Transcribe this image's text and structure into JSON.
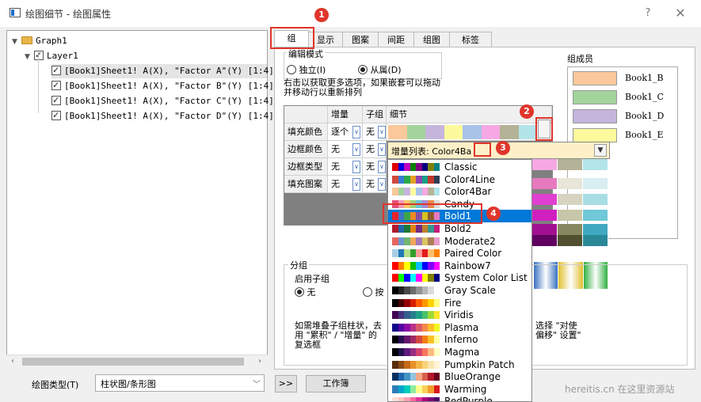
{
  "window": {
    "title": "绘图细节 - 绘图属性",
    "help_label": "?",
    "close_label": "✕"
  },
  "tree": {
    "root": "Graph1",
    "layer": "Layer1",
    "items": [
      "[Book1]Sheet1! A(X), \"Factor A\"(Y) [1:4]",
      "[Book1]Sheet1! A(X), \"Factor B\"(Y) [1:4]",
      "[Book1]Sheet1! A(X), \"Factor C\"(Y) [1:4]",
      "[Book1]Sheet1! A(X), \"Factor D\"(Y) [1:4]"
    ]
  },
  "bottom": {
    "plot_type_label": "绘图类型(T)",
    "plot_type_value": "柱状图/条形图",
    "expand_label": ">>",
    "workbook_label": "工作簿",
    "watermark": "hereitis.cn 在这里资源站"
  },
  "tabs": [
    "组",
    "显示",
    "图案",
    "间距",
    "组图",
    "标签"
  ],
  "edit_mode": {
    "title": "编辑模式",
    "independent": "独立(I)",
    "dependent": "从属(D)"
  },
  "hint": [
    "右击以获取更多选项，如果嵌套可以拖动",
    "并移动行以重新排列"
  ],
  "grid": {
    "headers": [
      "增量",
      "子组",
      "细节"
    ],
    "rows": [
      {
        "name": "填充颜色",
        "inc": "逐个",
        "sub": "无"
      },
      {
        "name": "边框颜色",
        "inc": "无",
        "sub": "无"
      },
      {
        "name": "边框类型",
        "inc": "无",
        "sub": "无"
      },
      {
        "name": "填充图案",
        "inc": "无",
        "sub": "无"
      }
    ],
    "details_colors": [
      "#f9c89b",
      "#a3d49c",
      "#c5b5dd",
      "#fdfa9e",
      "#a7c3e8",
      "#f6a8e4",
      "#b4b297",
      "#b2e4ea"
    ]
  },
  "members": {
    "title": "组成员",
    "items": [
      {
        "label": "Book1_B",
        "color": "#f9c89b"
      },
      {
        "label": "Book1_C",
        "color": "#a3d49c"
      },
      {
        "label": "Book1_D",
        "color": "#c5b5dd"
      },
      {
        "label": "Book1_E",
        "color": "#fdfa9e"
      }
    ]
  },
  "subgroup": {
    "title": "分组",
    "enable_label": "启用子组",
    "option_none": "无",
    "option_by": "按",
    "note": [
      "如需堆叠子组柱状，去",
      "选择 \"对使",
      "用 \"累积\" / \"增量\" 的",
      "偏移\" 设置\"",
      "复选框"
    ]
  },
  "dropdown": {
    "header": "增量列表: Color4Ba",
    "items": [
      {
        "name": "Classic",
        "colors": [
          "#e00000",
          "#0000e0",
          "#c000c0",
          "#008000",
          "#800080",
          "#000080",
          "#808000",
          "#008080"
        ]
      },
      {
        "name": "Color4Line",
        "colors": [
          "#d04a3c",
          "#3a7bd5",
          "#2aa84a",
          "#e6a020",
          "#8e44ad",
          "#16a085",
          "#c0392b",
          "#2c3e50"
        ]
      },
      {
        "name": "Color4Bar",
        "colors": [
          "#f9c89b",
          "#a3d49c",
          "#c5b5dd",
          "#fdfa9e",
          "#a7c3e8",
          "#f6a8e4",
          "#b4b297",
          "#b2e4ea"
        ]
      },
      {
        "name": "Candy",
        "colors": [
          "#e5517a",
          "#f29cb7",
          "#f6c86a",
          "#9fd37a",
          "#6cc3d5",
          "#a58bd6",
          "#e88b4d",
          "#d9d9d9"
        ]
      },
      {
        "name": "Bold1",
        "colors": [
          "#e8242a",
          "#3c76c5",
          "#3aa447",
          "#f08b22",
          "#884ea0",
          "#d9c022",
          "#8c5a2b",
          "#e779bf"
        ]
      },
      {
        "name": "Bold2",
        "colors": [
          "#b2182b",
          "#2166ac",
          "#1b7837",
          "#e08214",
          "#762a83",
          "#bf812d",
          "#35978f",
          "#c51b7d"
        ]
      },
      {
        "name": "Moderate2",
        "colors": [
          "#e4665e",
          "#6a96cf",
          "#70b571",
          "#f2a65a",
          "#a57ab7",
          "#d9c55e",
          "#ad7f55",
          "#ea9dcb"
        ]
      },
      {
        "name": "Paired Color",
        "colors": [
          "#a6cee3",
          "#1f78b4",
          "#b2df8a",
          "#33a02c",
          "#fb9a99",
          "#e31a1c",
          "#fdbf6f",
          "#ff7f00"
        ]
      },
      {
        "name": "Rainbow7",
        "colors": [
          "#ff0000",
          "#ff8000",
          "#ffff00",
          "#00c000",
          "#00c0ff",
          "#0000ff",
          "#8000ff",
          "#ff00ff"
        ]
      },
      {
        "name": "System Color List",
        "colors": [
          "#ff0000",
          "#00ff00",
          "#0000ff",
          "#00ffff",
          "#ff00ff",
          "#ffff00",
          "#808000",
          "#000080"
        ]
      },
      {
        "name": "Gray Scale",
        "colors": [
          "#000000",
          "#242424",
          "#494949",
          "#6d6d6d",
          "#929292",
          "#b6b6b6",
          "#dbdbdb",
          "#ffffff"
        ]
      },
      {
        "name": "Fire",
        "colors": [
          "#000000",
          "#4a0000",
          "#960000",
          "#d81e00",
          "#ff5a00",
          "#ff9600",
          "#ffd200",
          "#ffff80"
        ]
      },
      {
        "name": "Viridis",
        "colors": [
          "#440154",
          "#46327e",
          "#365c8d",
          "#277f8e",
          "#1fa187",
          "#4ac16d",
          "#a0da39",
          "#fde725"
        ]
      },
      {
        "name": "Plasma",
        "colors": [
          "#0d0887",
          "#5402a3",
          "#8b0aa5",
          "#b93289",
          "#db5c68",
          "#f48849",
          "#febd2a",
          "#f0f921"
        ]
      },
      {
        "name": "Inferno",
        "colors": [
          "#000004",
          "#280b53",
          "#65156e",
          "#9f2a63",
          "#d44842",
          "#f57d15",
          "#fac127",
          "#fcffa4"
        ]
      },
      {
        "name": "Magma",
        "colors": [
          "#000004",
          "#221150",
          "#5f187f",
          "#982d80",
          "#d3436e",
          "#f8765c",
          "#febb81",
          "#fcfdbf"
        ]
      },
      {
        "name": "Pumpkin Patch",
        "colors": [
          "#5a2d0c",
          "#8c4a14",
          "#c46a1a",
          "#e8922a",
          "#f4b64a",
          "#f7d27a",
          "#f8e6ae",
          "#fff4d6"
        ]
      },
      {
        "name": "BlueOrange",
        "colors": [
          "#053061",
          "#2166ac",
          "#4393c3",
          "#92c5de",
          "#f4a582",
          "#d6604d",
          "#b2182b",
          "#67001f"
        ]
      },
      {
        "name": "Warming",
        "colors": [
          "#2c7bb6",
          "#00a6ca",
          "#00ccbc",
          "#90eb9d",
          "#ffff8c",
          "#f9d057",
          "#f29e2e",
          "#d7191c"
        ]
      },
      {
        "name": "RedPurple",
        "colors": [
          "#fde0dd",
          "#fcc5c0",
          "#fa9fb5",
          "#f768a1",
          "#dd3497",
          "#ae017e",
          "#7a0177",
          "#49006a"
        ]
      }
    ]
  },
  "preview_rows": [
    [
      "#f6a8e4",
      "#b4b297",
      "#b2e4ea"
    ],
    [
      "#e779bf",
      "#e8e6d8",
      "#d8eef2"
    ],
    [
      "#e040d0",
      "#d6d4c0",
      "#a8dde6"
    ],
    [
      "#d020c0",
      "#c8c6a8",
      "#70c8d8"
    ],
    [
      "#a01090",
      "#888860",
      "#40a8c0"
    ],
    [
      "#600060",
      "#505030",
      "#2a8898"
    ]
  ],
  "annotations": [
    "1",
    "2",
    "3",
    "4"
  ]
}
